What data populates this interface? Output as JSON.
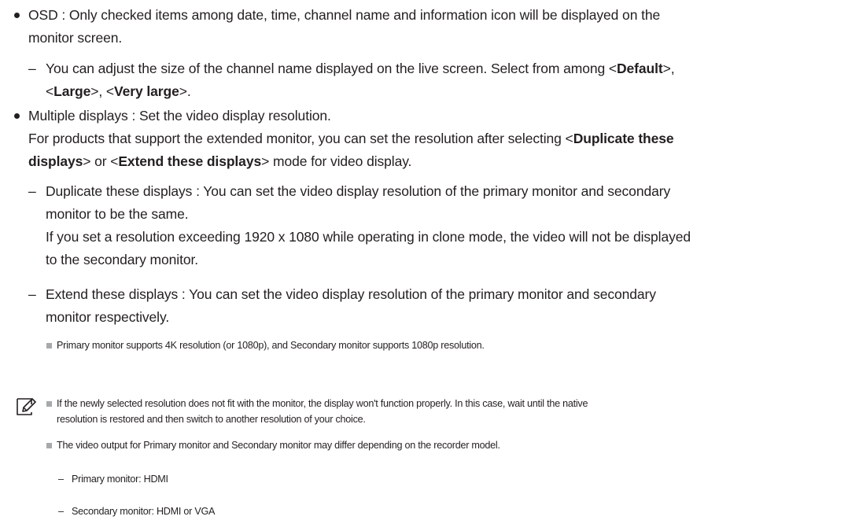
{
  "osd": {
    "line1": "OSD : Only checked items among date, time, channel name and information icon will be displayed on the",
    "line2": "monitor screen.",
    "sub": {
      "dash": "–",
      "l1_pre": "You can adjust the size of the channel name displayed on the live screen. Select from among <",
      "default": "Default",
      "l1_post": ">,",
      "l2_a": "<",
      "large": "Large",
      "l2_b": ">, <",
      "very_large": "Very large",
      "l2_c": ">."
    }
  },
  "multiple": {
    "line1": "Multiple displays : Set the video display resolution.",
    "line2_pre": "For products that support the extended monitor, you can set the resolution after selecting <",
    "dup_bold_a": "Duplicate these",
    "dup_bold_b": "displays",
    "line3_mid": "> or <",
    "ext_bold": "Extend these displays",
    "line3_post": "> mode for video display.",
    "duplicate": {
      "dash": "–",
      "l1": "Duplicate these displays : You can set the video display resolution of the primary monitor and secondary",
      "l2": "monitor to be the same.",
      "l3": "If you set a resolution exceeding 1920 x 1080 while operating in clone mode, the video will not be displayed",
      "l4": "to the secondary monitor."
    },
    "extend": {
      "dash": "–",
      "l1": "Extend these displays : You can set the video display resolution of the primary monitor and secondary",
      "l2": "monitor respectively.",
      "note": "Primary monitor supports 4K resolution (or 1080p), and Secondary monitor supports 1080p resolution."
    }
  },
  "notes": {
    "icon": "note-pencil-icon",
    "n1_l1": "If the newly selected resolution does not fit with the monitor, the display won't function properly. In this case, wait until the native",
    "n1_l2": "resolution is restored and then switch to another resolution of your choice.",
    "n2": "The video output for Primary monitor and Secondary monitor may differ depending on the recorder model.",
    "sub1": "Primary monitor: HDMI",
    "sub2": "Secondary monitor: HDMI or VGA",
    "dash": "–"
  },
  "colors": {
    "text": "#231f20",
    "square_bullet": "#a7a9ac"
  }
}
